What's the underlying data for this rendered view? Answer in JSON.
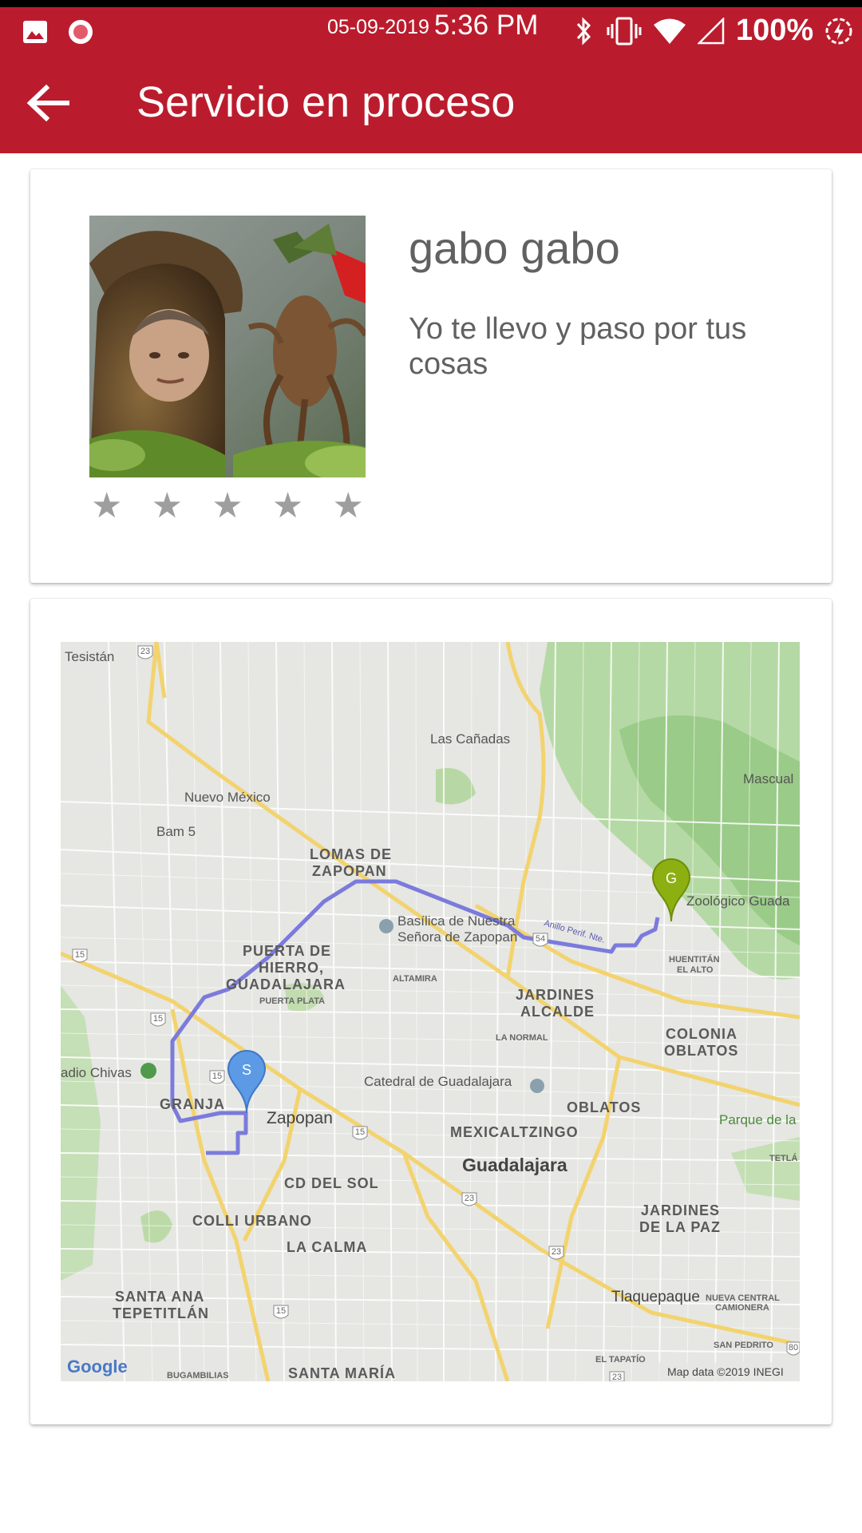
{
  "status_bar": {
    "date": "05-09-2019",
    "time": "5:36 PM",
    "battery": "100%",
    "icons": [
      "image-icon",
      "record-icon",
      "bluetooth-icon",
      "vibrate-icon",
      "wifi-icon",
      "signal-icon",
      "battery-saver-icon"
    ],
    "color": "#bb1c2d"
  },
  "app_bar": {
    "title": "Servicio en proceso",
    "back_icon": "arrow-back-icon",
    "color": "#bb1c2d"
  },
  "driver": {
    "name": "gabo gabo",
    "message": "Yo te llevo y paso por tus cosas",
    "rating": 0,
    "max_rating": 5
  },
  "map": {
    "start_marker": "S",
    "end_marker": "G",
    "attribution": "Map data ©2019 INEGI",
    "logo": "Google",
    "route_color": "#7b7bdc",
    "labels": {
      "tesistan": "Tesistán",
      "las_canadas": "Las Cañadas",
      "mascual": "Mascual",
      "nuevo_mexico": "Nuevo México",
      "bam5": "Bam 5",
      "lomas1": "LOMAS DE",
      "lomas2": "ZAPOPAN",
      "zoo": "Zoológico Guada",
      "basilica1": "Basílica de Nuestra",
      "basilica2": "Señora de Zapopan",
      "anillo": "Anillo Perif. Nte.",
      "huentitan1": "HUENTITÁN",
      "huentitan2": "EL ALTO",
      "puerta1": "PUERTA DE",
      "puerta2": "HIERRO,",
      "puerta3": "GUADALAJARA",
      "puerta_plata": "PUERTA PLATA",
      "altamira": "ALTAMIRA",
      "jardines_alcalde1": "JARDINES",
      "jardines_alcalde2": "ALCALDE",
      "colonia1": "COLONIA",
      "colonia2": "OBLATOS",
      "la_normal": "LA NORMAL",
      "estadio": "adio Chivas",
      "catedral": "Catedral de Guadalajara",
      "granja": "GRANJA",
      "zapopan": "Zapopan",
      "oblatos": "OBLATOS",
      "parque": "Parque de la",
      "tetlan": "TETLÁ",
      "mexicaltzingo": "MEXICALTZINGO",
      "guadalajara": "Guadalajara",
      "cd_sol": "CD DEL SOL",
      "colli": "COLLI URBANO",
      "jardines_paz1": "JARDINES",
      "jardines_paz2": "DE LA PAZ",
      "la_calma": "LA CALMA",
      "santa_ana1": "SANTA ANA",
      "santa_ana2": "TEPETITLÁN",
      "tlaquepaque": "Tlaquepaque",
      "nueva_central1": "NUEVA CENTRAL",
      "nueva_central2": "CAMIONERA",
      "san_pedrito": "SAN PEDRITO",
      "el_tapatio": "EL TAPATÍO",
      "bugambilias": "BUGAMBILIAS",
      "santa_maria": "SANTA MARÍA"
    },
    "shields": {
      "s23a": "23",
      "s15a": "15",
      "s54": "54",
      "s15b": "15",
      "s15c": "15",
      "s15d": "15",
      "s23b": "23",
      "s23c": "23",
      "s15e": "15",
      "s80": "80",
      "s23d": "23"
    }
  }
}
